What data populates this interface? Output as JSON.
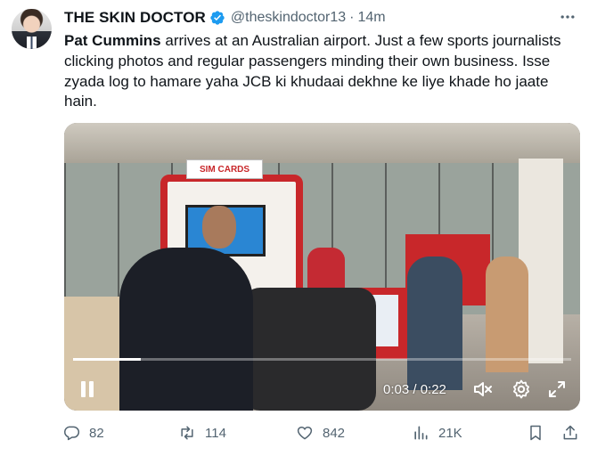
{
  "tweet": {
    "author_name": "THE SKIN DOCTOR",
    "handle": "@theskindoctor13",
    "separator": "·",
    "time": "14m",
    "text_bold": "Pat Cummins",
    "text_rest": " arrives at an Australian airport. Just a few sports journalists clicking photos and regular passengers minding their own business. Isse zyada log to hamare yaha JCB ki khudaai dekhne ke liye khade ho jaate hain."
  },
  "video": {
    "time_display": "0:03 / 0:22",
    "progress": 0.136,
    "sign_text": "SIM CARDS"
  },
  "actions": {
    "replies": "82",
    "reposts": "114",
    "likes": "842",
    "views": "21K"
  },
  "colors": {
    "verified": "#1d9bf0",
    "secondary_text": "#536471",
    "kiosk_red": "#c8272a"
  },
  "icons": {
    "verified": "verified-badge-icon",
    "more": "more-icon",
    "pause": "pause-icon",
    "mute": "volume-muted-icon",
    "settings": "settings-gear-icon",
    "fullscreen": "fullscreen-icon",
    "reply": "reply-icon",
    "repost": "repost-icon",
    "like": "like-heart-icon",
    "views": "views-chart-icon",
    "bookmark": "bookmark-icon",
    "share": "share-icon"
  }
}
